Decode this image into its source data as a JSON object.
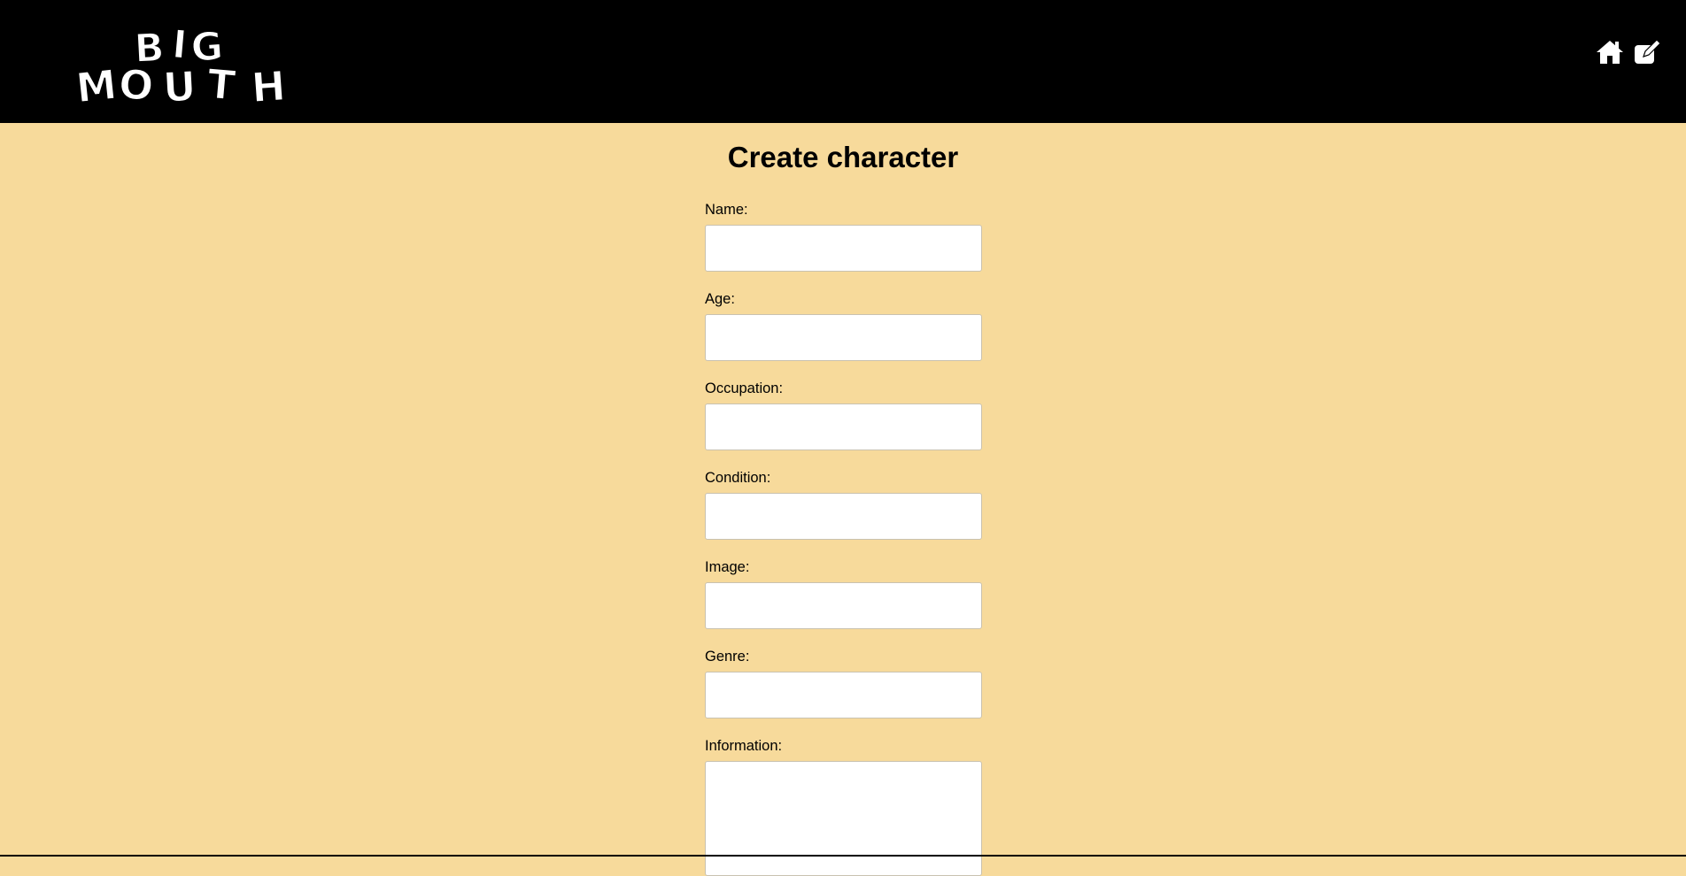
{
  "header": {
    "logo_text_line1": "BIG",
    "logo_text_line2": "MOUTH",
    "nav": [
      {
        "icon": "home-icon"
      },
      {
        "icon": "edit-icon"
      }
    ]
  },
  "page": {
    "title": "Create character"
  },
  "form": {
    "fields": [
      {
        "label": "Name:",
        "value": "",
        "placeholder": ""
      },
      {
        "label": "Age:",
        "value": "",
        "placeholder": ""
      },
      {
        "label": "Occupation:",
        "value": "",
        "placeholder": ""
      },
      {
        "label": "Condition:",
        "value": "",
        "placeholder": ""
      },
      {
        "label": "Image:",
        "value": "",
        "placeholder": ""
      },
      {
        "label": "Genre:",
        "value": "",
        "placeholder": ""
      },
      {
        "label": "Information:",
        "value": "",
        "placeholder": ""
      }
    ]
  },
  "colors": {
    "header_bg": "#000000",
    "page_bg": "#f7da9b",
    "input_bg": "#ffffff"
  }
}
